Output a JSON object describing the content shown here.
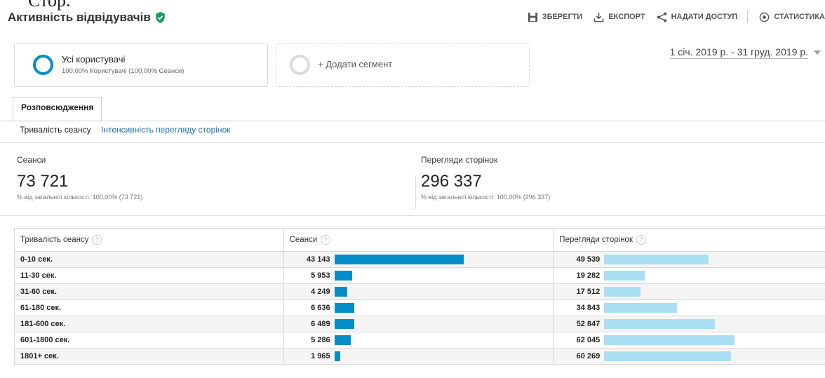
{
  "top_clip": "Стор.",
  "header": {
    "title": "Активність відвідувачів",
    "toolbar": {
      "save": "ЗБЕРЕГТИ",
      "export": "ЕКСПОРТ",
      "share": "НАДАТИ ДОСТУП",
      "insights": "СТАТИСТИКА"
    }
  },
  "segments": {
    "active": {
      "name": "Усі користувачі",
      "sub": "100,00% Користувачі (100,00% Сеанси)"
    },
    "add_label": "+ Додати сегмент"
  },
  "date_range": "1 січ. 2019 р. - 31 груд. 2019 р.",
  "tabs": [
    {
      "label": "Розповсюдження"
    }
  ],
  "sublinks": {
    "active": "Тривалість сеансу",
    "other": "Інтенсивність перегляду сторінок"
  },
  "metrics": [
    {
      "label": "Сеанси",
      "value": "73 721",
      "sub": "% від загальної кількості: 100,00% (73 721)"
    },
    {
      "label": "Перегляди сторінок",
      "value": "296 337",
      "sub": "% від загальної кількості: 100,00% (296 337)"
    }
  ],
  "table": {
    "headers": [
      "Тривалість сеансу",
      "Сеанси",
      "Перегляди сторінок"
    ],
    "rows": [
      {
        "label": "0-10 сек.",
        "sessions": "43 143",
        "sessions_val": 43143,
        "pageviews": "49 539",
        "pageviews_val": 49539
      },
      {
        "label": "11-30 сек.",
        "sessions": "5 953",
        "sessions_val": 5953,
        "pageviews": "19 282",
        "pageviews_val": 19282
      },
      {
        "label": "31-60 сек.",
        "sessions": "4 249",
        "sessions_val": 4249,
        "pageviews": "17 512",
        "pageviews_val": 17512
      },
      {
        "label": "61-180 сек.",
        "sessions": "6 636",
        "sessions_val": 6636,
        "pageviews": "34 843",
        "pageviews_val": 34843
      },
      {
        "label": "181-600 сек.",
        "sessions": "6 489",
        "sessions_val": 6489,
        "pageviews": "52 847",
        "pageviews_val": 52847
      },
      {
        "label": "601-1800 сек.",
        "sessions": "5 286",
        "sessions_val": 5286,
        "pageviews": "62 045",
        "pageviews_val": 62045
      },
      {
        "label": "1801+ сек.",
        "sessions": "1 965",
        "sessions_val": 1965,
        "pageviews": "60 269",
        "pageviews_val": 60269
      }
    ]
  },
  "colors": {
    "sessions_bar": "#058dc7",
    "pageviews_bar": "#aadff3",
    "verified": "#0f9d58",
    "link": "#1a6fa8"
  },
  "icons": {
    "verified": "shield-check-icon",
    "save": "floppy-disk-icon",
    "export": "download-tray-icon",
    "share": "share-nodes-icon",
    "insights": "insights-icon",
    "help": "help-circle-icon",
    "dropdown": "caret-down-icon"
  }
}
